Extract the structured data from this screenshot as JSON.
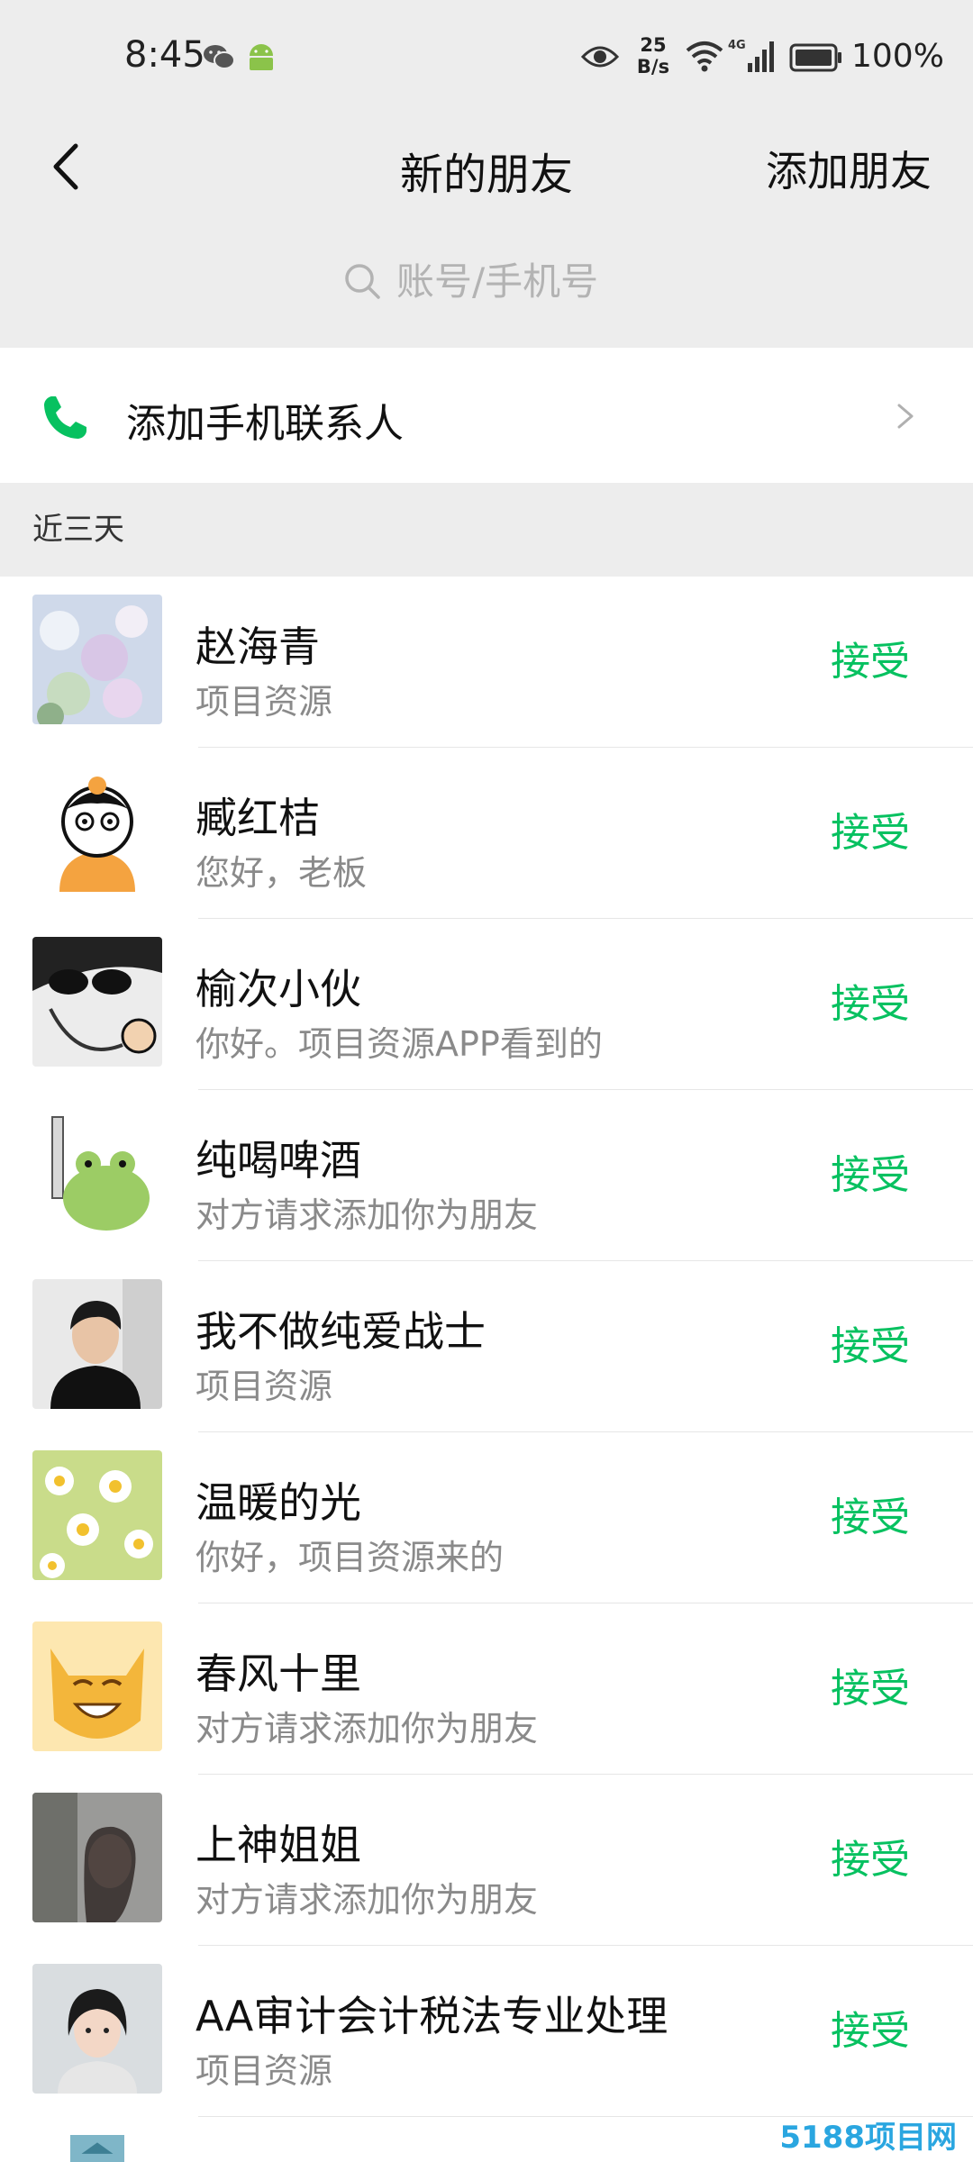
{
  "status_bar": {
    "time": "8:45",
    "net_speed_value": "25",
    "net_speed_unit": "B/s",
    "network": "4G",
    "battery": "100%",
    "icons": [
      "wechat-icon",
      "android-icon",
      "eye-icon",
      "wifi-icon",
      "signal-icon",
      "battery-icon"
    ]
  },
  "header": {
    "title": "新的朋友",
    "action": "添加朋友"
  },
  "search": {
    "placeholder": "账号/手机号"
  },
  "add_contacts": {
    "label": "添加手机联系人"
  },
  "section": {
    "label": "近三天"
  },
  "requests": [
    {
      "name": "赵海青",
      "message": "项目资源",
      "action": "接受"
    },
    {
      "name": "臧红桔",
      "message": "您好，老板",
      "action": "接受"
    },
    {
      "name": "榆次小伙",
      "message": "你好。项目资源APP看到的",
      "action": "接受"
    },
    {
      "name": "纯喝啤酒",
      "message": "对方请求添加你为朋友",
      "action": "接受"
    },
    {
      "name": "我不做纯爱战士",
      "message": "项目资源",
      "action": "接受"
    },
    {
      "name": "温暖的光",
      "message": "你好，项目资源来的",
      "action": "接受"
    },
    {
      "name": "春风十里",
      "message": "对方请求添加你为朋友",
      "action": "接受"
    },
    {
      "name": "上神姐姐",
      "message": "对方请求添加你为朋友",
      "action": "接受"
    },
    {
      "name": "AA审计会计税法专业处理",
      "message": "项目资源",
      "action": "接受"
    }
  ],
  "watermark": "5188项目网",
  "colors": {
    "accent": "#07c160",
    "background": "#ededed",
    "card": "#ffffff",
    "secondary_text": "#8a8a8a"
  }
}
